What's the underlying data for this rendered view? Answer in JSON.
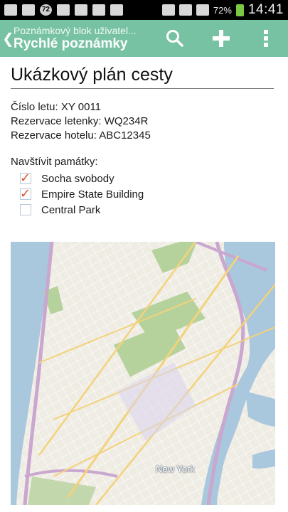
{
  "status_bar": {
    "notification_badge": "72",
    "battery": "72%",
    "time": "14:41"
  },
  "action_bar": {
    "subtitle": "Poznámkový blok uživatel...",
    "title": "Rychlé poznámky",
    "icons": [
      "chevron-left-icon",
      "search-icon",
      "plus-icon",
      "more-vertical-icon"
    ]
  },
  "note": {
    "title": "Ukázkový plán cesty",
    "info_lines": [
      "Číslo letu: XY 0011",
      "Rezervace letenky: WQ234R",
      "Rezervace hotelu: ABC12345"
    ],
    "sights_heading": "Navštívit památky:",
    "checklist": [
      {
        "label": "Socha svobody",
        "checked": true
      },
      {
        "label": "Empire State Building",
        "checked": true
      },
      {
        "label": "Central Park",
        "checked": false
      }
    ]
  },
  "map": {
    "city_label": "New York",
    "colors": {
      "water": "#a9c7dd",
      "land": "#efece4",
      "park": "#b6d29c",
      "highway": "#c9a7cf",
      "major_road": "#f3d27a"
    }
  },
  "colors": {
    "action_bar": "#78c2a4",
    "check_mark": "#d9532a"
  }
}
